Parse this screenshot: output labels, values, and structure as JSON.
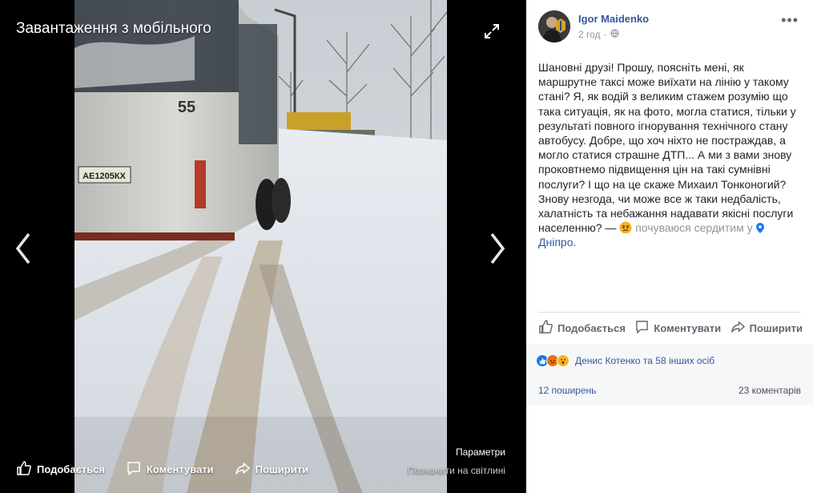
{
  "viewer": {
    "title": "Завантаження з мобільного",
    "params_label": "Параметри",
    "tag_label": "Позначити на світлині",
    "actions": {
      "like": "Подобається",
      "comment": "Коментувати",
      "share": "Поширити"
    },
    "bus_route_number": "55",
    "bus_plate": "АЕ1205КХ"
  },
  "post": {
    "author": "Igor Maidenko",
    "time": "2 год",
    "text_main": "Шановні друзі! Прошу, поясніть мені, як маршрутне таксі може виїхати на лінію у такому стані? Я, як водій з великим стажем розумію що така ситуація, як на фото, могла статися, тільки у результаті повного ігнорування технічного стану автобусу. Добре, що хоч ніхто не постраждав, а могло статися страшне ДТП... А ми з вами знову проковтнемо підвищення цін на такі сумнівні послуги? І що на це скаже Михаил Тонконогий? Знову незгода, чи може все ж таки недбалість, халатність та небажання надавати якісні послуги населенню? —",
    "feeling": "почуваюся сердитим у",
    "location": "Дніпро."
  },
  "actions": {
    "like": "Подобається",
    "comment": "Коментувати",
    "share": "Поширити"
  },
  "reactions": {
    "text": "Денис Котенко та 58 інших осіб",
    "shares": "12 поширень",
    "comments": "23 коментарів"
  },
  "colors": {
    "link": "#365899",
    "muted": "#90949c",
    "like_blue": "#1877f2",
    "angry": "#e9710f",
    "wow": "#f7b125"
  },
  "icons": [
    "expand-icon",
    "chevron-left-icon",
    "chevron-right-icon",
    "thumbs-up-icon",
    "comment-icon",
    "share-icon",
    "globe-icon",
    "more-icon",
    "angry-emoji-icon",
    "location-pin-icon"
  ]
}
